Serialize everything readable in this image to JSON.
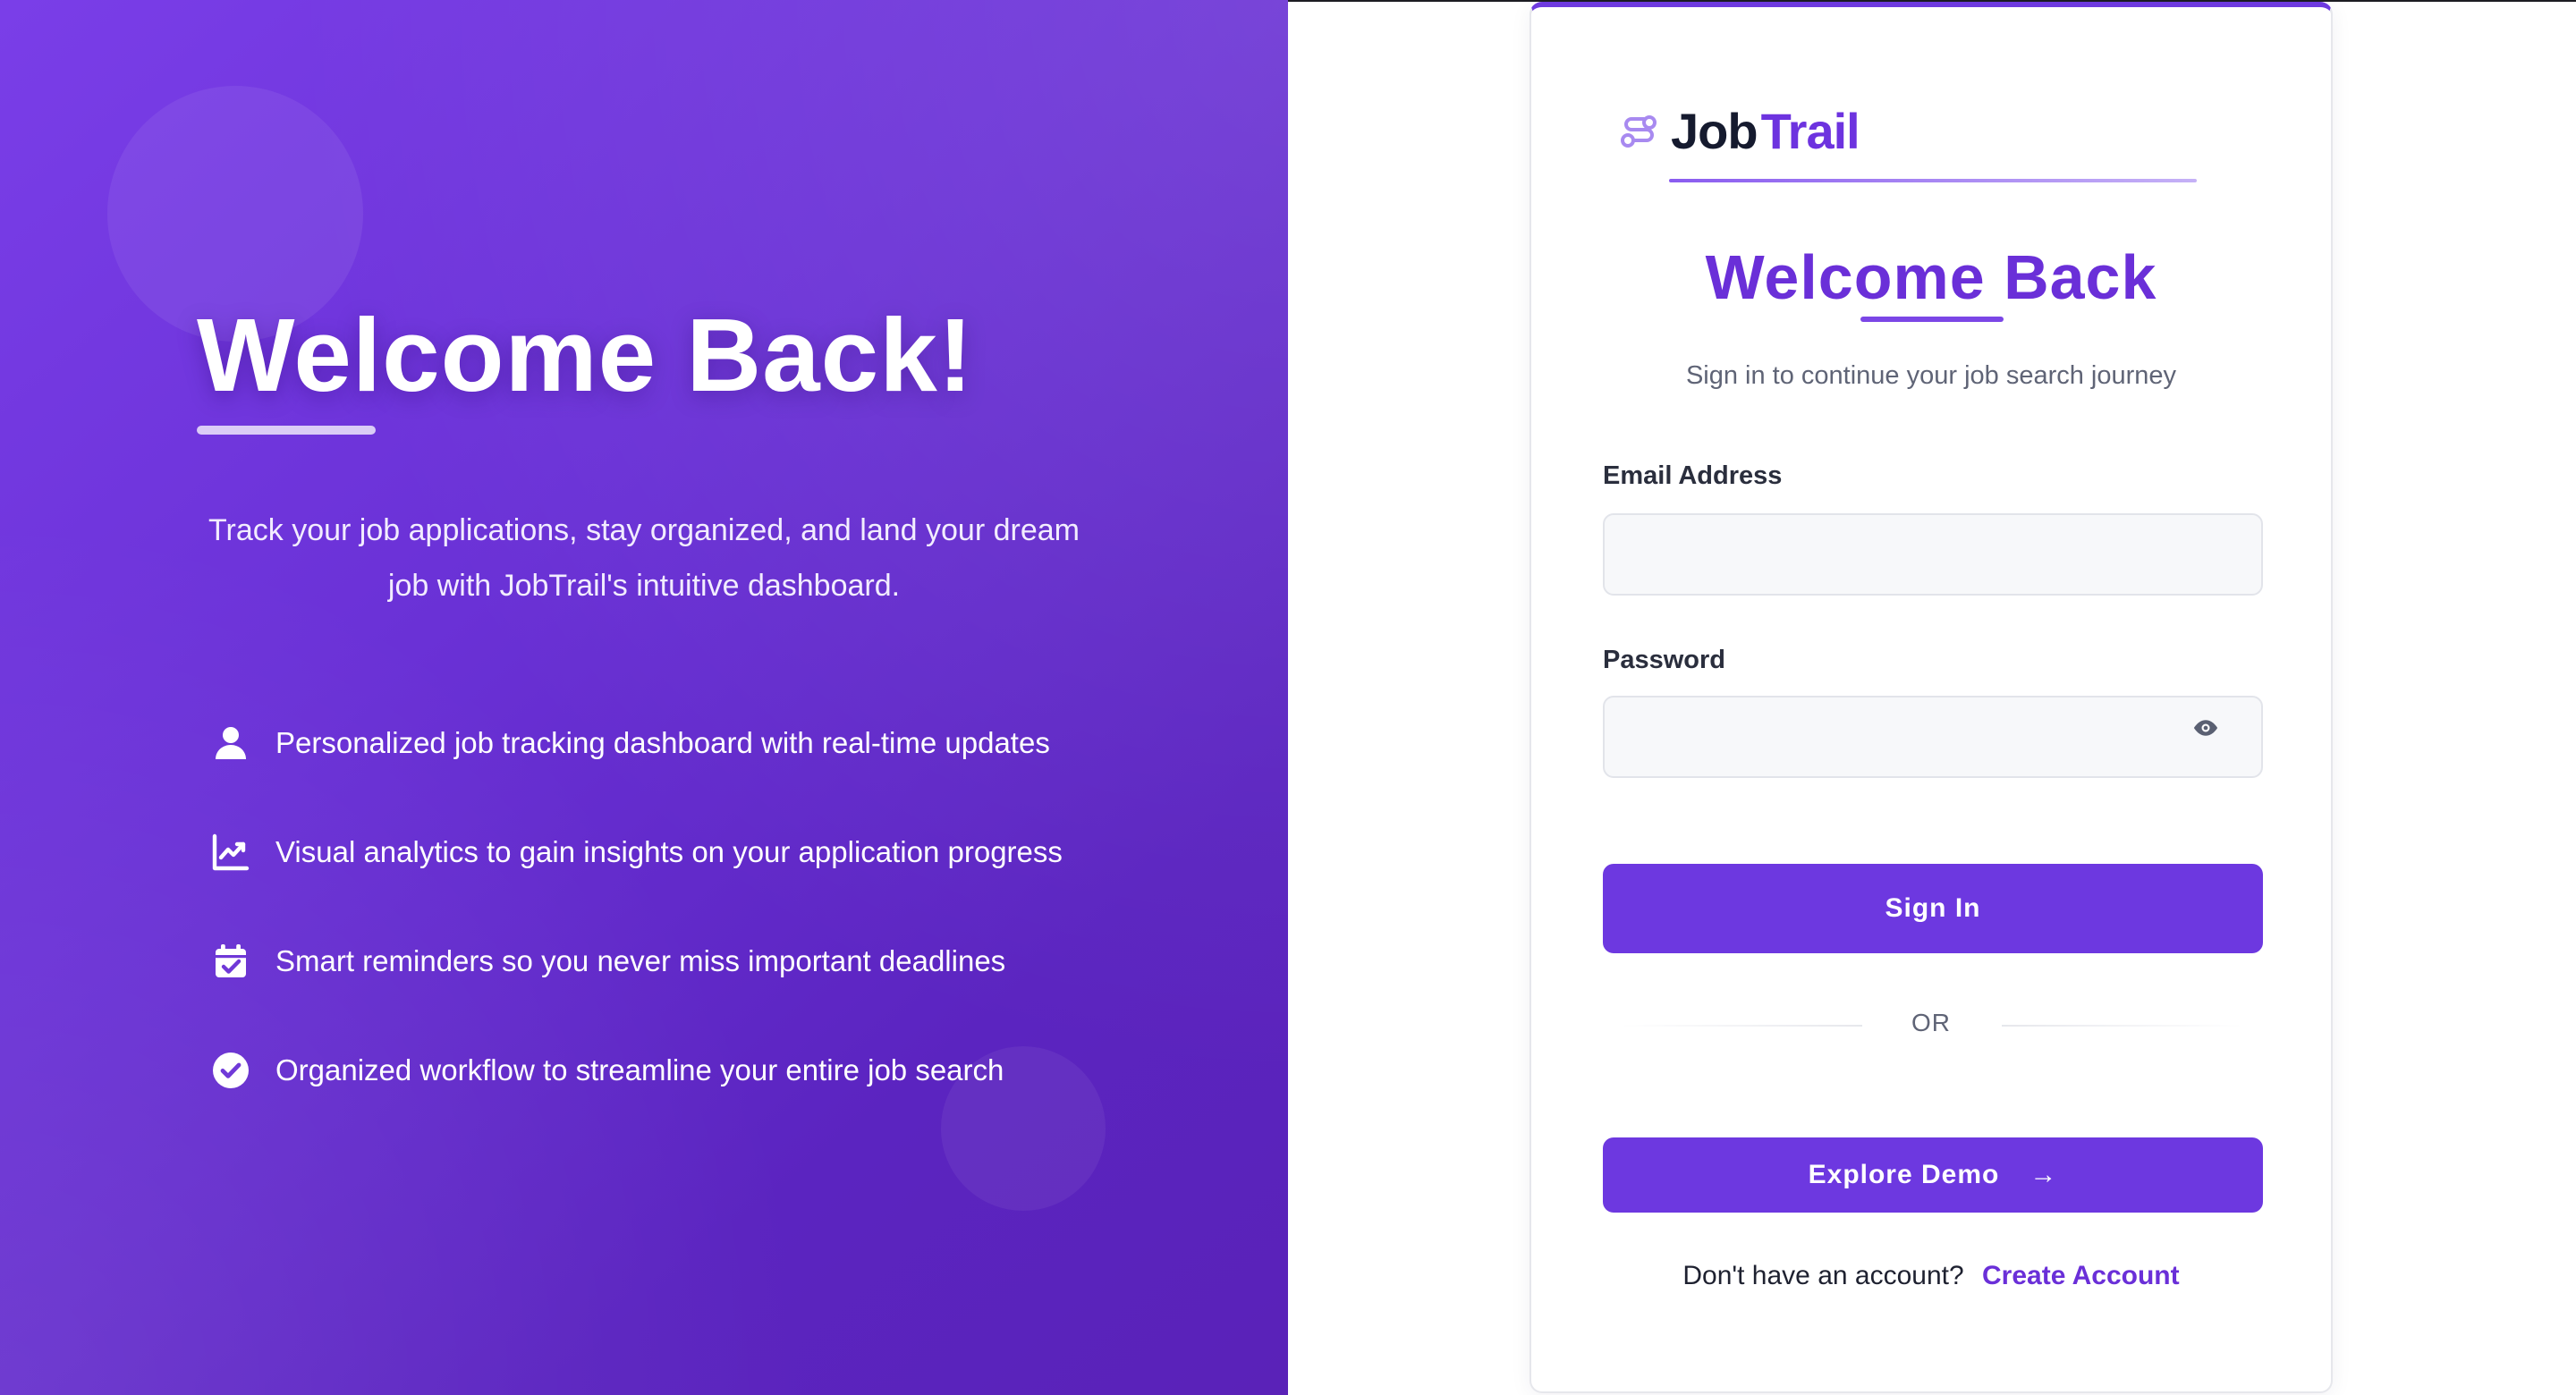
{
  "hero": {
    "title": "Welcome Back!",
    "description": "Track your job applications, stay organized, and land your dream job with JobTrail's intuitive dashboard.",
    "features": [
      {
        "icon": "user-icon",
        "text": "Personalized job tracking dashboard with real-time updates"
      },
      {
        "icon": "chart-line-icon",
        "text": "Visual analytics to gain insights on your application progress"
      },
      {
        "icon": "calendar-check-icon",
        "text": "Smart reminders so you never miss important deadlines"
      },
      {
        "icon": "check-circle-icon",
        "text": "Organized workflow to streamline your entire job search"
      }
    ]
  },
  "logo": {
    "icon": "route-icon",
    "part1": "Job",
    "part2": "Trail"
  },
  "form": {
    "title": "Welcome Back",
    "subtitle": "Sign in to continue your job search journey",
    "email_label": "Email Address",
    "email_value": "",
    "password_label": "Password",
    "password_value": "",
    "password_toggle_icon": "eye-icon",
    "sign_in_label": "Sign In",
    "divider_text": "OR",
    "demo_label": "Explore Demo",
    "demo_arrow": "→",
    "signup_prompt": "Don't have an account?",
    "create_account_label": "Create Account"
  },
  "colors": {
    "brand_primary": "#6d38e0",
    "brand_title": "#6a2fd8",
    "hero_gradient_start": "#7a3ee8",
    "hero_gradient_end": "#5a22b8",
    "text_dark": "#2a2e3d",
    "text_muted": "#5f6476"
  }
}
